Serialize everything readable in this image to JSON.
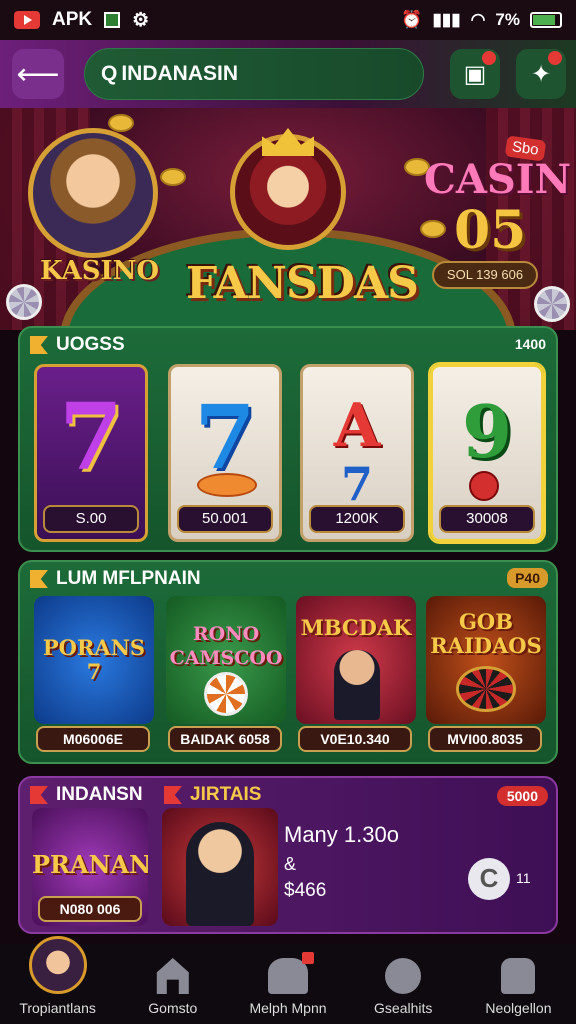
{
  "status_bar": {
    "app_label": "APK",
    "battery_text": "7%"
  },
  "header": {
    "search_value": "INDANASIN"
  },
  "hero": {
    "left_logo": "KASINO",
    "center_logo": "FANSDAS",
    "right_logo_top": "CASIN",
    "right_logo_num": "05",
    "corner_badge": "Sbo",
    "pill_text": "SOL 139 606"
  },
  "section_slots": {
    "title": "UOGSS",
    "badge": "1400",
    "reels": [
      {
        "top": "7",
        "bottom": "",
        "price": "S.00",
        "color": "#8a2fb0"
      },
      {
        "top": "7",
        "bottom": "",
        "price": "50.001",
        "color": "#1e88e5"
      },
      {
        "top": "A",
        "bottom": "7",
        "price": "1200K",
        "color": "#e53935"
      },
      {
        "top": "9",
        "bottom": "",
        "price": "30008",
        "color": "#2e9d3a"
      }
    ]
  },
  "section_tiles": {
    "title": "LUM MFLPNAIN",
    "badge": "P40",
    "tiles": [
      {
        "title": "PORANS 7",
        "price": "M06006E",
        "bg": "#1565c0"
      },
      {
        "title": "RONO CAMSCOO",
        "price": "BAIDAK 6058",
        "bg": "#2e7d32"
      },
      {
        "title": "MBCDAK",
        "price": "V0E10.340",
        "bg": "#b02a2a"
      },
      {
        "title": "GOB RAIDAOS",
        "price": "MVI00.8035",
        "bg": "#8a2a0e"
      }
    ]
  },
  "section_promo": {
    "title_left": "INDANSN",
    "title_right": "JIRTAIS",
    "badge": "5000",
    "card_title": "PRANAN",
    "card_price": "N080 006",
    "text_line1": "Many 1.30o",
    "text_line2": "&",
    "text_line3": "$466",
    "small_text": "11"
  },
  "nav": [
    {
      "label": "Tropiantlans"
    },
    {
      "label": "Gomsto"
    },
    {
      "label": "Melph Mpnn"
    },
    {
      "label": "Gsealhits"
    },
    {
      "label": "Neolgellon"
    }
  ]
}
